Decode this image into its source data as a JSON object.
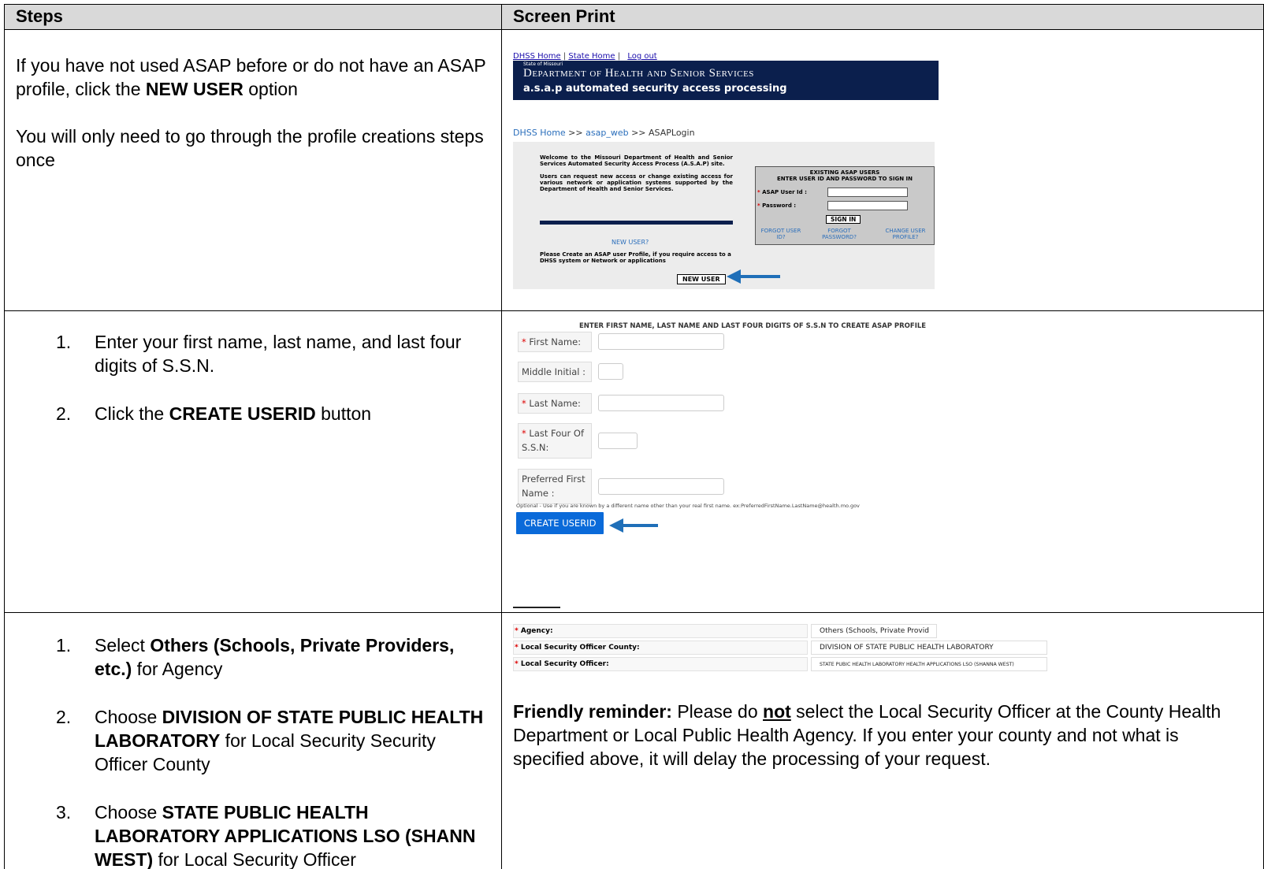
{
  "headers": {
    "steps": "Steps",
    "screen_print": "Screen Print"
  },
  "row1": {
    "para1_pre": "If you have not used ASAP before or do not have an ASAP profile, click the ",
    "para1_bold": "NEW USER",
    "para1_post": " option",
    "para2": "You will only need to go through the profile creations steps once"
  },
  "shot1": {
    "nav_home": "DHSS Home",
    "nav_sep": "|",
    "nav_state": "State Home",
    "nav_logout": "Log out",
    "banner_small": "State of Missouri",
    "banner_dept": "Department of Health and Senior Services",
    "banner_asap": "a.s.a.p  automated security access processing",
    "crumb_home": "DHSS Home",
    "crumb_sep1": " >> ",
    "crumb_web": "asap_web",
    "crumb_sep2": " >> ",
    "crumb_here": "ASAPLogin",
    "welcome1": "Welcome to the Missouri Department of Health and Senior Services Automated Security Access Process (A.S.A.P) site.",
    "welcome2": "Users can request new access or change existing access for various network or application systems supported by the Department of Health and Senior Services.",
    "newuser_link": "NEW USER?",
    "please": "Please Create an ASAP user Profile, if you require access to a DHSS system or Network or applications",
    "newuser_btn": "NEW USER",
    "existing_hdr1": "EXISTING ASAP USERS",
    "existing_hdr2": "ENTER USER ID AND PASSWORD TO SIGN IN",
    "req": "*",
    "userid_label": " ASAP User Id :",
    "password_label": " Password :",
    "signin": "SIGN IN",
    "forgot_id": "FORGOT USER ID?",
    "forgot_pw": "FORGOT PASSWORD?",
    "change_profile": "CHANGE USER PROFILE?"
  },
  "row2": {
    "step1": "Enter your first name, last name, and last four digits of S.S.N.",
    "step2_pre": "Click the ",
    "step2_bold": "CREATE USERID",
    "step2_post": " button",
    "num1": "1.",
    "num2": "2."
  },
  "shot2": {
    "title": "ENTER FIRST NAME,  LAST NAME AND LAST FOUR  DIGITS OF S.S.N TO CREATE ASAP PROFILE",
    "req": "*",
    "first_name": " First Name:",
    "middle_initial": "Middle Initial :",
    "last_name": " Last Name:",
    "last_four": " Last Four Of S.S.N:",
    "preferred": "Preferred First Name :",
    "optional": "Optional - Use if you are known by a different name other than your real first name. ex:PreferredFirstName.LastName@health.mo.gov",
    "create_btn": "CREATE USERID"
  },
  "row3": {
    "num1": "1.",
    "num2": "2.",
    "num3": "3.",
    "s1_pre": "Select ",
    "s1_bold": "Others (Schools, Private Providers, etc.)",
    "s1_post": " for Agency",
    "s2_pre": "Choose ",
    "s2_bold": "DIVISION OF STATE PUBLIC HEALTH LABORATORY",
    "s2_post": " for Local Security Security Officer County",
    "s3_pre": "Choose ",
    "s3_bold": "STATE PUBLIC HEALTH LABORATORY APPLICATIONS LSO (SHANN WEST)",
    "s3_post": " for Local Security Officer"
  },
  "shot3": {
    "req": "*",
    "agency_label": " Agency:",
    "agency_value": "Others (Schools, Private Provid",
    "county_label": " Local Security Officer County:",
    "county_value": "DIVISION OF STATE PUBLIC HEALTH LABORATORY",
    "officer_label": " Local Security Officer:",
    "officer_value": "STATE PUBIC HEALTH LABORATORY HEALTH APPLICATIONS LSO (SHANNA WEST)",
    "reminder_bold": "Friendly reminder:",
    "reminder_pre": "  Please do ",
    "reminder_not": "not",
    "reminder_post": " select the Local Security Officer at the County Health Department or Local Public Health Agency.   If you enter your county and not what is specified above, it will delay the processing of your request."
  },
  "colors": {
    "banner": "#0b1f4d",
    "arrow": "#1f6fb8",
    "button": "#0a6ad9",
    "header_bg": "#d9d9d9"
  },
  "icons": [
    "arrow-left-icon"
  ]
}
